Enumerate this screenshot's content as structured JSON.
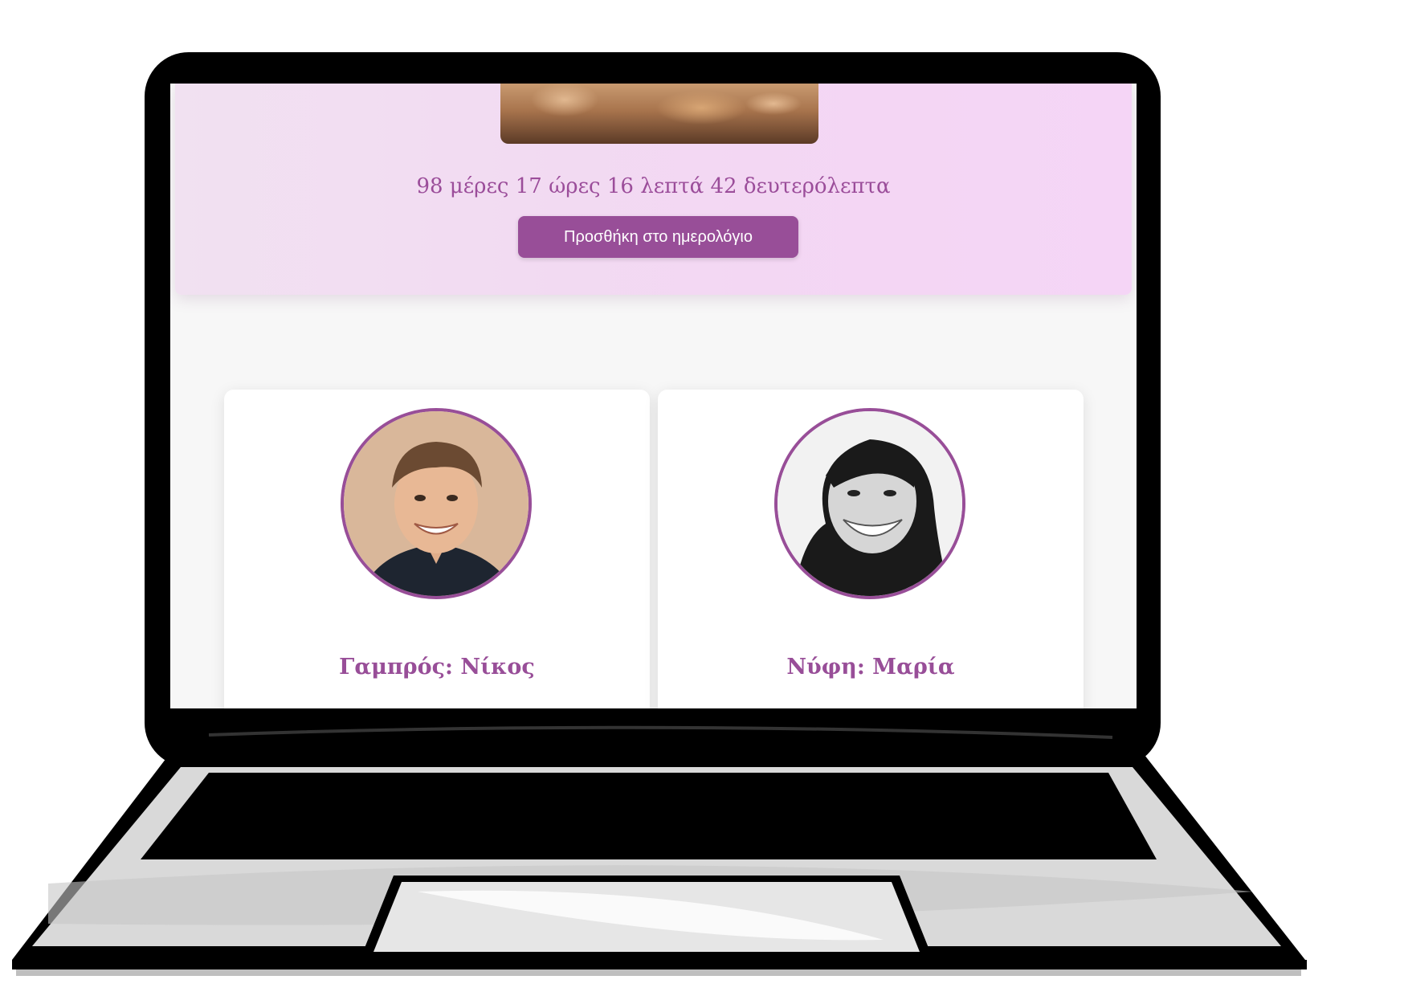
{
  "hero": {
    "countdown_text": "98 μέρες 17 ώρες 16 λεπτά 42 δευτερόλεπτα",
    "calendar_button_label": "Προσθήκη στο ημερολόγιο"
  },
  "couple": [
    {
      "role_name": "Γαμπρός: Νίκος"
    },
    {
      "role_name": "Νύφη: Μαρία"
    }
  ],
  "colors": {
    "accent": "#984e98",
    "hero_background": "#f3d7f3",
    "page_background": "#f7f7f7",
    "card_background": "#ffffff"
  }
}
